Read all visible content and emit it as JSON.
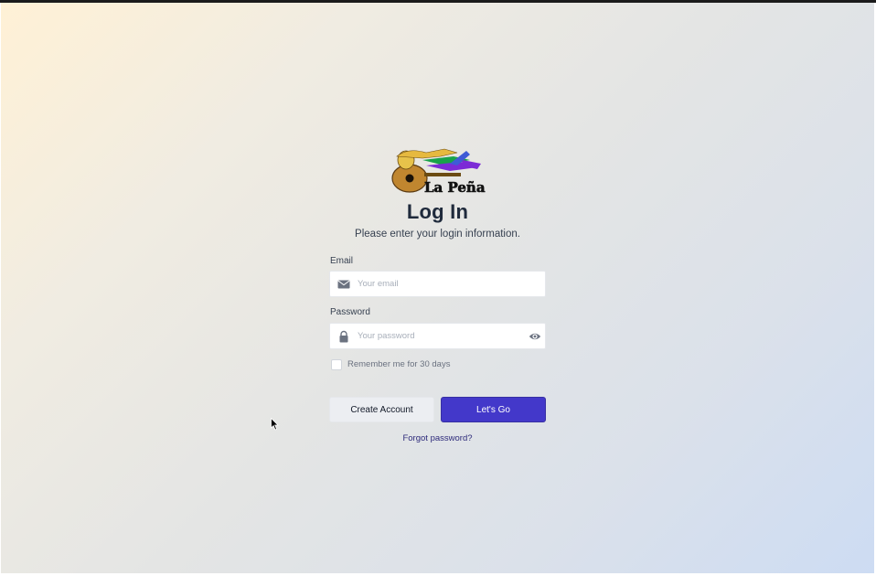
{
  "brand": {
    "logo_alt": "La Peña",
    "logo_icon": "guitar-logo"
  },
  "login": {
    "title": "Log In",
    "subtitle": "Please enter your login information.",
    "email": {
      "label": "Email",
      "placeholder": "Your email",
      "value": "",
      "icon": "mail-icon"
    },
    "password": {
      "label": "Password",
      "placeholder": "Your password",
      "value": "",
      "icon": "lock-icon",
      "toggle_icon": "eye-icon"
    },
    "remember": {
      "label": "Remember me for 30 days",
      "checked": false
    },
    "create_account_label": "Create Account",
    "submit_label": "Let's Go",
    "forgot_label": "Forgot password?"
  },
  "colors": {
    "primary": "#4338ca",
    "heading": "#1f2a3c",
    "gradient_start": "#fff1d6",
    "gradient_end": "#cddcf3"
  }
}
